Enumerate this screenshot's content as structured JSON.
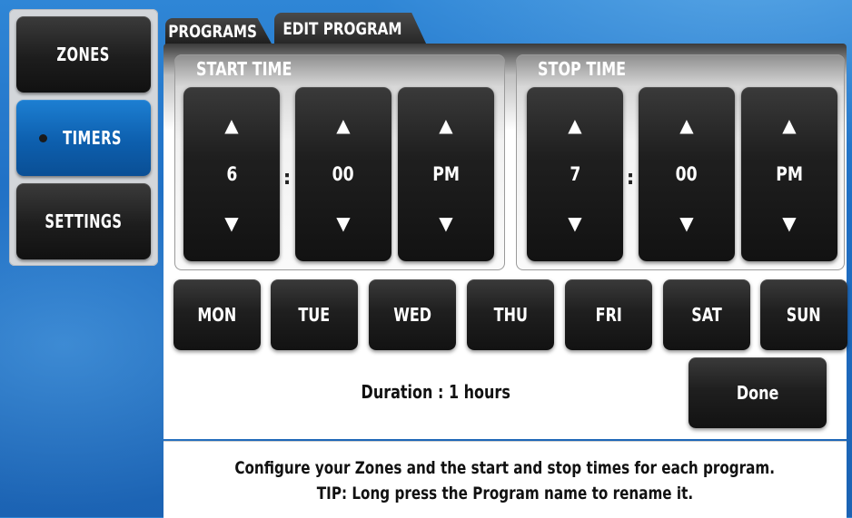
{
  "sidebar": {
    "items": [
      {
        "label": "ZONES",
        "active": false
      },
      {
        "label": "TIMERS",
        "active": true
      },
      {
        "label": "SETTINGS",
        "active": false
      }
    ]
  },
  "tabs": [
    {
      "label": "PROGRAMS",
      "active": false
    },
    {
      "label": "EDIT PROGRAM",
      "active": true
    }
  ],
  "start_time": {
    "title": "START TIME",
    "hour": "6",
    "minute": "00",
    "ampm": "PM",
    "separator": ":"
  },
  "stop_time": {
    "title": "STOP TIME",
    "hour": "7",
    "minute": "00",
    "ampm": "PM",
    "separator": ":"
  },
  "arrows": {
    "up": "▲",
    "down": "▼"
  },
  "days": [
    "MON",
    "TUE",
    "WED",
    "THU",
    "FRI",
    "SAT",
    "SUN"
  ],
  "duration": "Duration : 1 hours",
  "done_label": "Done",
  "tip": {
    "line1": "Configure your Zones and the start and stop times for each program.",
    "line2": "TIP: Long press the Program name to rename it."
  },
  "colors": {
    "active_nav": "#0d5fae",
    "button_dark": "#1f1f1f",
    "background_blue": "#1f6fc4"
  }
}
